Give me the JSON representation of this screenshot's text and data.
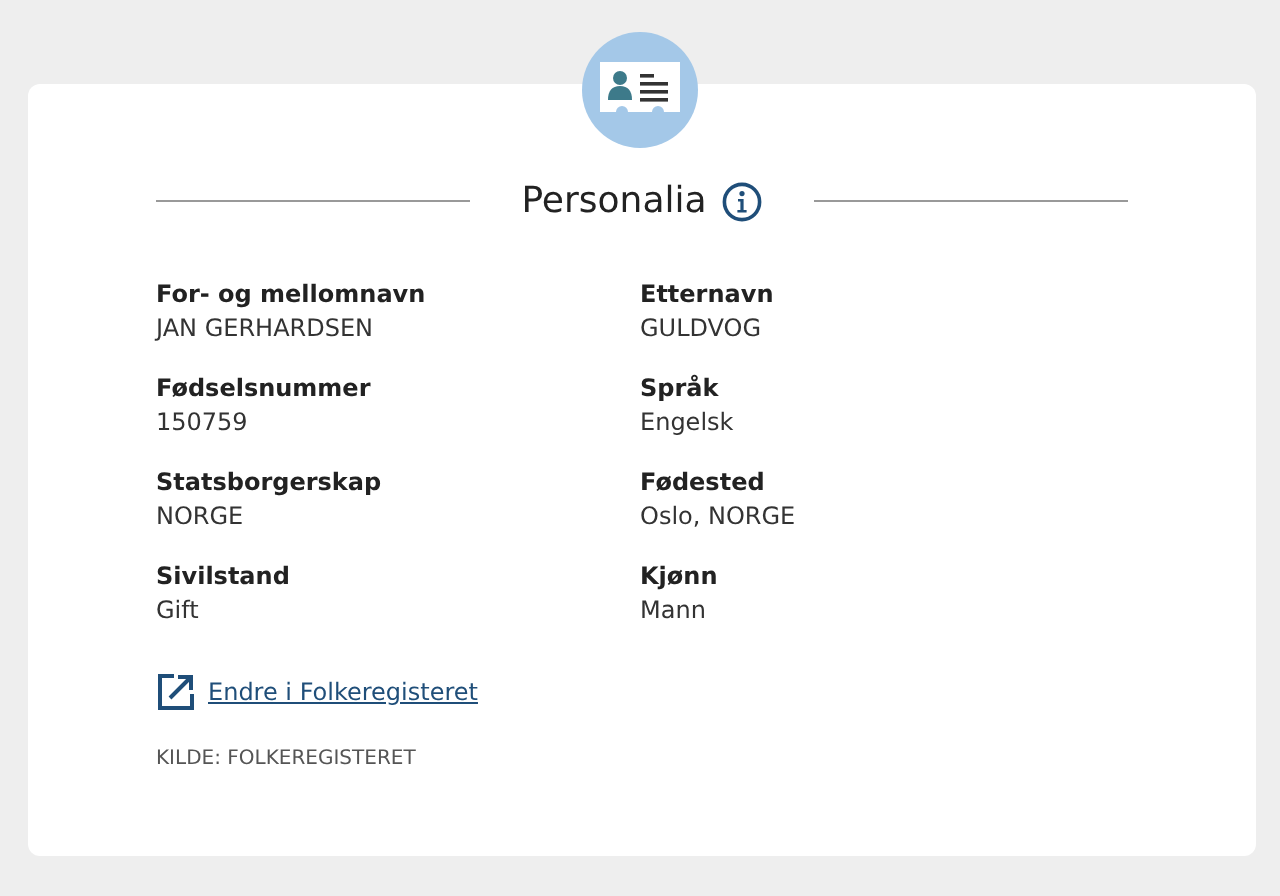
{
  "section": {
    "title": "Personalia"
  },
  "fields": [
    {
      "label": "For- og mellomnavn",
      "value": "JAN GERHARDSEN"
    },
    {
      "label": "Etternavn",
      "value": "GULDVOG"
    },
    {
      "label": "Fødselsnummer",
      "value": "150759"
    },
    {
      "label": "Språk",
      "value": "Engelsk"
    },
    {
      "label": "Statsborgerskap",
      "value": "NORGE"
    },
    {
      "label": "Fødested",
      "value": "Oslo, NORGE"
    },
    {
      "label": "Sivilstand",
      "value": "Gift"
    },
    {
      "label": "Kjønn",
      "value": "Mann"
    }
  ],
  "link": {
    "label": "Endre i Folkeregisteret"
  },
  "source": "KILDE: FOLKEREGISTERET"
}
